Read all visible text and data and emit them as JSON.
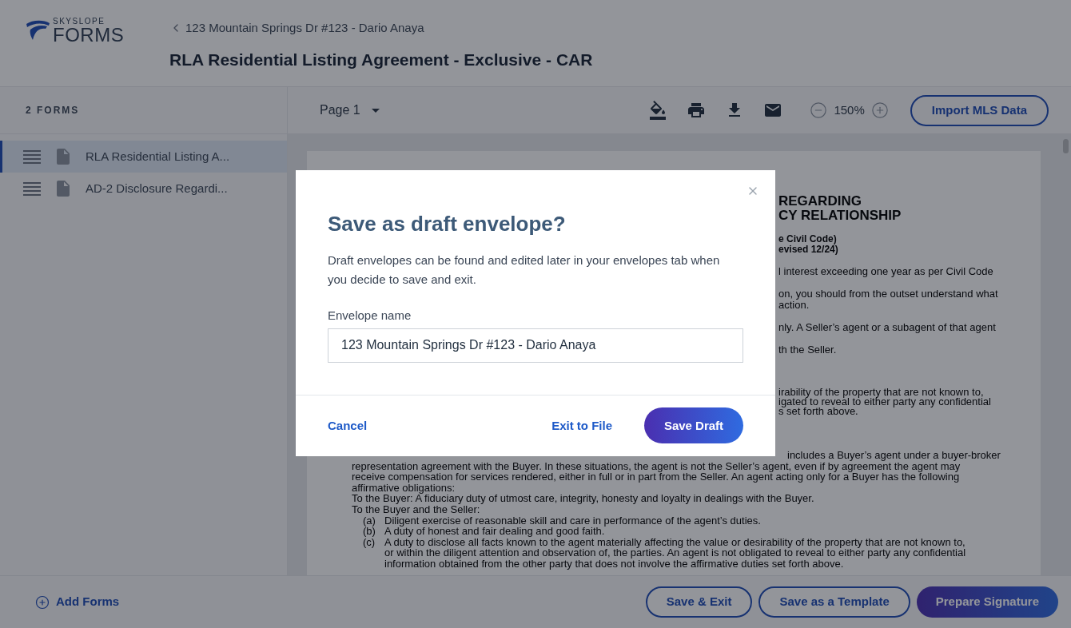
{
  "header": {
    "logo": {
      "brand_top": "SKYSLOPE",
      "brand": "FORMS"
    },
    "breadcrumb": "123 Mountain Springs Dr #123 - Dario Anaya",
    "title": "RLA Residential Listing Agreement - Exclusive - CAR"
  },
  "sidebar": {
    "heading": "2 FORMS",
    "items": [
      {
        "label": "RLA Residential Listing A...",
        "selected": true
      },
      {
        "label": "AD-2 Disclosure Regardi...",
        "selected": false
      }
    ]
  },
  "toolbar": {
    "page_select": "Page 1",
    "zoom": "150%",
    "import_button": "Import MLS Data"
  },
  "document": {
    "top_blocks": [
      {
        "kind": "heading",
        "lines": [
          "REGARDING",
          "CY RELATIONSHIP"
        ]
      },
      {
        "kind": "subheading",
        "lines": [
          "e Civil Code)",
          "evised 12/24)"
        ]
      },
      {
        "kind": "text",
        "lines": [
          "l interest exceeding one year as per Civil Code"
        ]
      },
      {
        "kind": "text",
        "lines": [
          "on, you should from the outset understand what",
          "action."
        ]
      },
      {
        "kind": "text",
        "lines": [
          "nly.  A Seller’s agent or a subagent of that agent"
        ]
      },
      {
        "kind": "text",
        "lines": [
          "th the Seller."
        ]
      },
      {
        "kind": "text-spaced",
        "lines": [
          "irability of the property that are not known to,",
          "igated to reveal to either party any confidential",
          "s set forth above."
        ]
      }
    ],
    "cut_line": "includes a Buyer’s agent under a buyer-broker",
    "lines": [
      {
        "kind": "line",
        "text": "representation agreement with the Buyer.  In these situations, the agent is not the Seller’s agent, even if by agreement the agent may"
      },
      {
        "kind": "line",
        "text": "receive compensation for services rendered, either in full or in part from the Seller.  An agent acting only for a Buyer has the following"
      },
      {
        "kind": "line",
        "text": "affirmative obligations:"
      },
      {
        "kind": "line",
        "text": "To the Buyer: A fiduciary duty of utmost care, integrity, honesty and loyalty in dealings with the Buyer."
      },
      {
        "kind": "line",
        "text": "To the Buyer and the Seller:"
      },
      {
        "kind": "item",
        "marker": "(a)",
        "text": "Diligent exercise of reasonable skill and care in performance of the agent’s duties."
      },
      {
        "kind": "item",
        "marker": "(b)",
        "text": "A duty of honest and fair dealing and good faith."
      },
      {
        "kind": "item",
        "marker": "(c)",
        "text": "A duty to disclose all facts known to the agent materially affecting the value or desirability of the property that are not known to,"
      },
      {
        "kind": "item",
        "text": "or within the diligent attention and observation of, the parties.  An agent is not obligated to reveal to either party any confidential"
      },
      {
        "kind": "item",
        "text": "information obtained from the other party that does not involve the affirmative duties set forth above."
      }
    ]
  },
  "footer": {
    "add_forms": "Add Forms",
    "buttons": [
      {
        "label": "Save & Exit",
        "kind": "outline"
      },
      {
        "label": "Save as a Template",
        "kind": "outline"
      },
      {
        "label": "Prepare Signature",
        "kind": "primary"
      }
    ]
  },
  "dialog": {
    "title": "Save as draft envelope?",
    "body": "Draft envelopes can be found and edited later in your envelopes tab when you decide to save and exit.",
    "field_label": "Envelope name",
    "field_value": "123 Mountain Springs Dr #123 - Dario Anaya",
    "cancel": "Cancel",
    "exit": "Exit to File",
    "save": "Save Draft"
  }
}
